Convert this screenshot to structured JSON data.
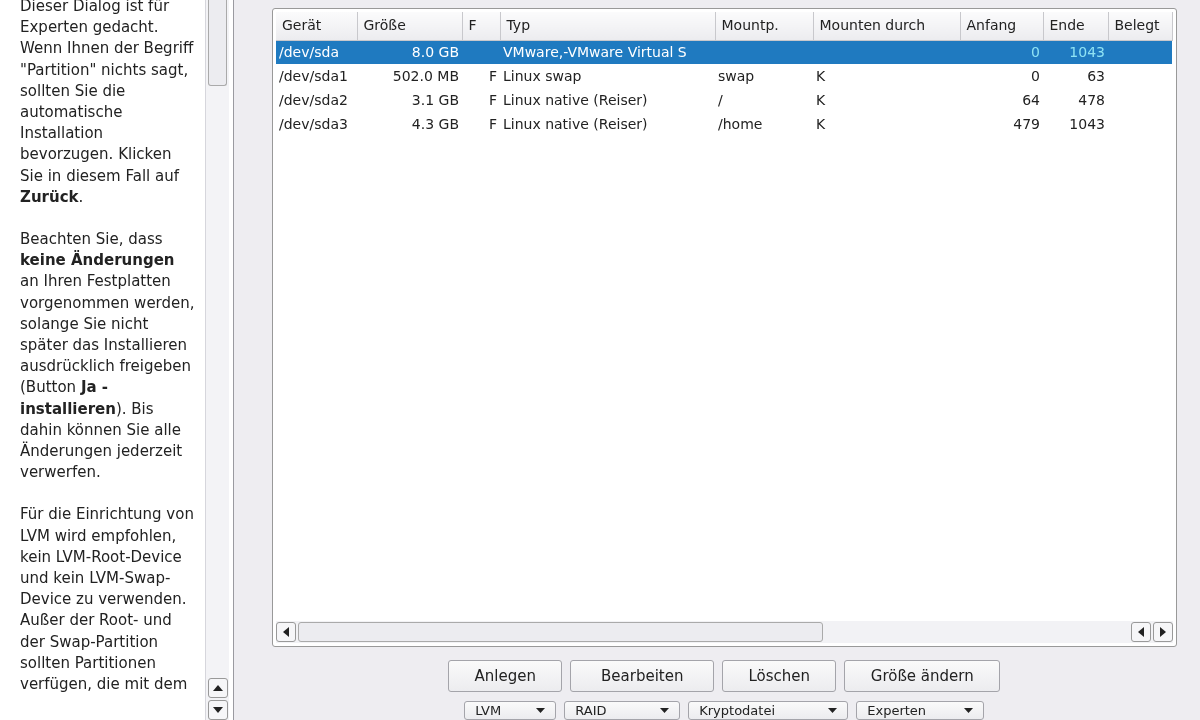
{
  "help_text": {
    "paragraphs": [
      "Dieser Dialog ist für Experten gedacht. Wenn Ihnen der Begriff \"Partition\" nichts sagt, sollten Sie die automatische Installation bevorzugen. Klicken Sie in diesem Fall auf **Zurück**.",
      "Beachten Sie, dass **keine Änderungen** an Ihren Festplatten vorgenommen werden, solange Sie nicht später das Installieren ausdrücklich freigeben (Button **Ja - installieren**). Bis dahin können Sie alle Änderungen jederzeit verwerfen.",
      "Für die Einrichtung von LVM wird empfohlen, kein LVM-Root-Device und kein LVM-Swap-Device zu verwenden. Außer der Root- und der Swap-Partition sollten Partitionen verfügen, die mit dem"
    ]
  },
  "table": {
    "columns": [
      {
        "label": "Gerät"
      },
      {
        "label": "Größe"
      },
      {
        "label": "F"
      },
      {
        "label": "Typ"
      },
      {
        "label": "Mountp."
      },
      {
        "label": "Mounten durch"
      },
      {
        "label": "Anfang"
      },
      {
        "label": "Ende"
      },
      {
        "label": "Belegt"
      }
    ],
    "rows": [
      {
        "selected": true,
        "cells": [
          "/dev/sda",
          "8.0 GB",
          "",
          "VMware,-VMware Virtual S",
          "",
          "",
          "0",
          "1043",
          ""
        ]
      },
      {
        "selected": false,
        "cells": [
          "/dev/sda1",
          "502.0 MB",
          "F",
          "Linux swap",
          "swap",
          "K",
          "0",
          "63",
          ""
        ]
      },
      {
        "selected": false,
        "cells": [
          "/dev/sda2",
          "3.1 GB",
          "F",
          "Linux native (Reiser)",
          "/",
          "K",
          "64",
          "478",
          ""
        ]
      },
      {
        "selected": false,
        "cells": [
          "/dev/sda3",
          "4.3 GB",
          "F",
          "Linux native (Reiser)",
          "/home",
          "K",
          "479",
          "1043",
          ""
        ]
      }
    ]
  },
  "buttons": [
    {
      "label": "Anlegen"
    },
    {
      "label": "Bearbeiten"
    },
    {
      "label": "Löschen"
    },
    {
      "label": "Größe ändern"
    }
  ],
  "menu_buttons": [
    {
      "label": "LVM"
    },
    {
      "label": "RAID"
    },
    {
      "label": "Kryptodatei"
    },
    {
      "label": "Experten"
    }
  ]
}
